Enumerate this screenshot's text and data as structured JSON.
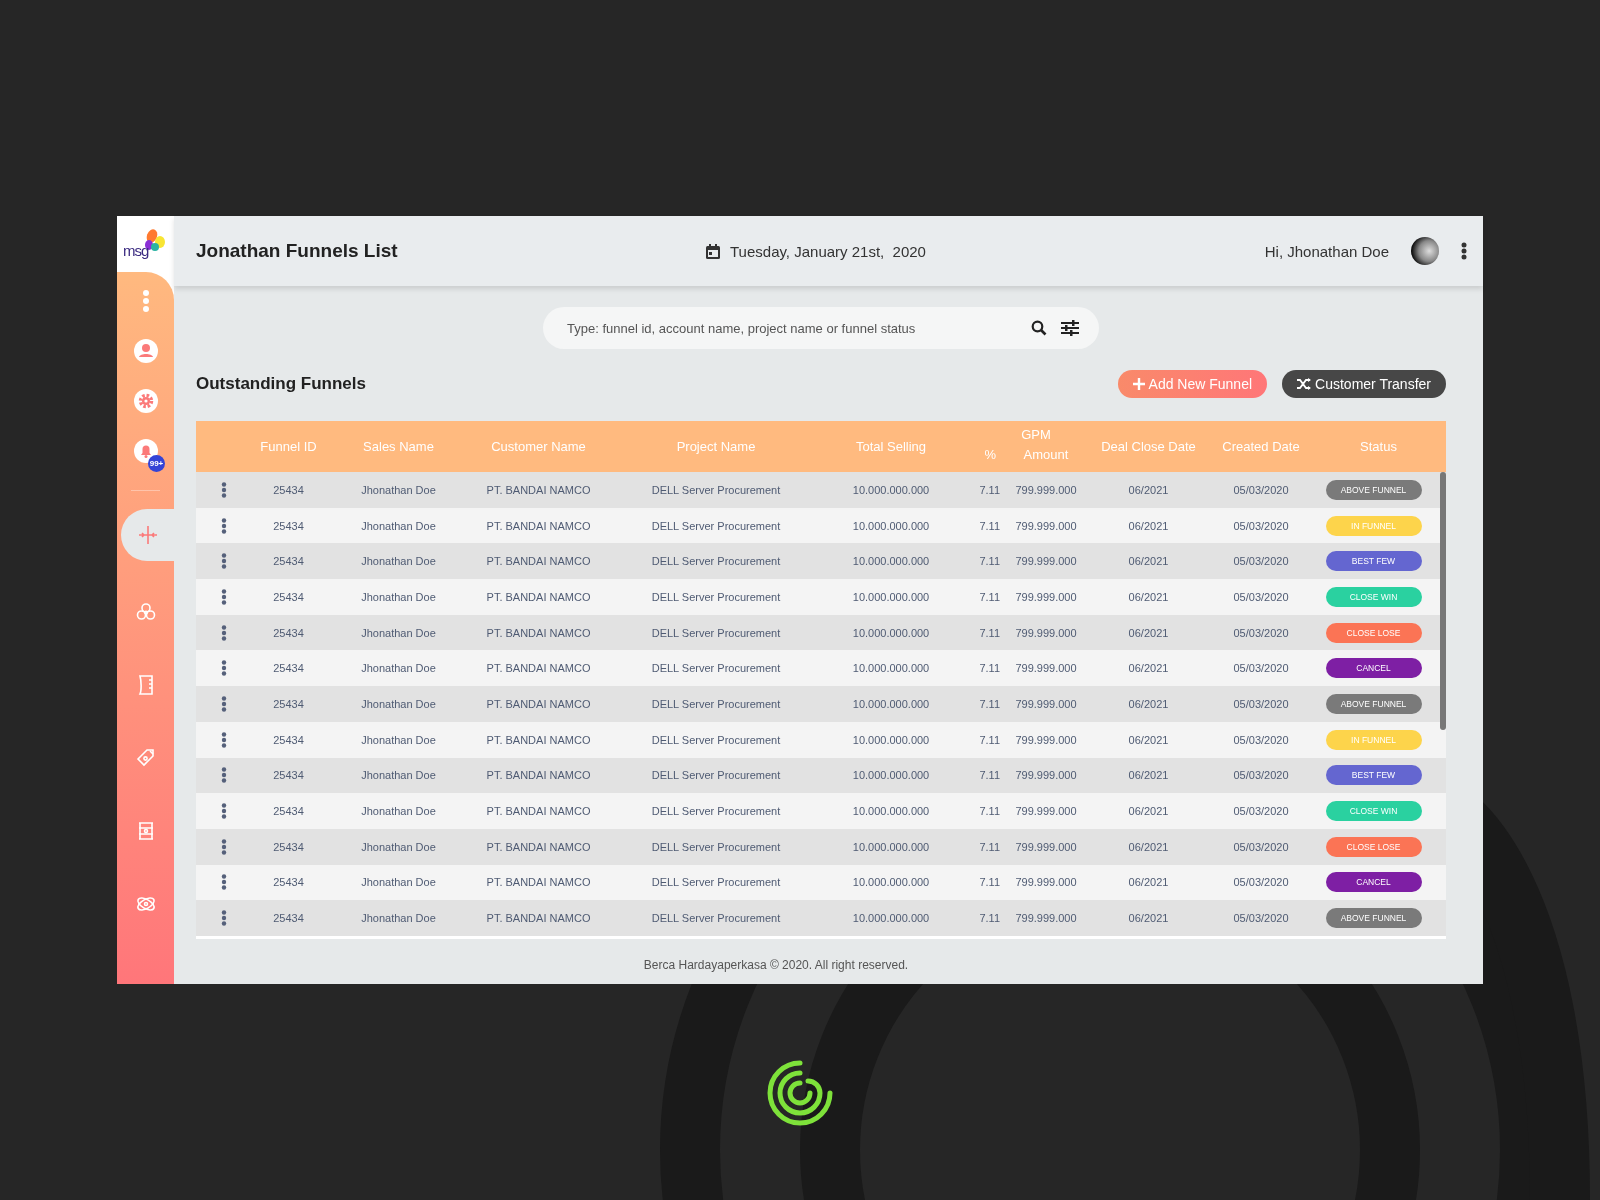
{
  "logo_text": "msg",
  "header": {
    "title": "Jonathan Funnels List",
    "date": "Tuesday, January 21st,  2020",
    "greeting": "Hi, Jhonathan Doe"
  },
  "sidebar": {
    "items": [
      {
        "kind": "more",
        "selected": false
      },
      {
        "kind": "user",
        "selected": false
      },
      {
        "kind": "settings",
        "selected": false
      },
      {
        "kind": "bell",
        "selected": false,
        "badge": "99+"
      },
      {
        "kind": "crosshair",
        "selected": true
      },
      {
        "kind": "biohazard",
        "selected": false
      },
      {
        "kind": "ruler",
        "selected": false
      },
      {
        "kind": "tag",
        "selected": false
      },
      {
        "kind": "barrel",
        "selected": false
      },
      {
        "kind": "atom",
        "selected": false
      }
    ]
  },
  "search": {
    "placeholder": "Type: funnel id, account name, project name or funnel status"
  },
  "section_title": "Outstanding Funnels",
  "buttons": [
    {
      "kind": "add",
      "label": "Add New Funnel"
    },
    {
      "kind": "transfer",
      "label": "Customer Transfer"
    }
  ],
  "table": {
    "columns": [
      "Funnel ID",
      "Sales Name",
      "Customer Name",
      "Project Name",
      "Total Selling",
      {
        "group": "GPM",
        "sub": [
          "%",
          "Amount"
        ]
      },
      "Deal Close Date",
      "Created Date",
      "Status"
    ],
    "rows": [
      {
        "id": "25434",
        "sales": "Jhonathan Doe",
        "customer": "PT. BANDAI NAMCO",
        "project": "DELL Server Procurement",
        "total": "10.000.000.000",
        "gpm_pct": "7.11",
        "gpm_amount": "799.999.000",
        "deal_close": "06/2021",
        "created": "05/03/2020",
        "status": "ABOVE FUNNEL",
        "color": "#7a7a7a"
      },
      {
        "id": "25434",
        "sales": "Jhonathan Doe",
        "customer": "PT. BANDAI NAMCO",
        "project": "DELL Server Procurement",
        "total": "10.000.000.000",
        "gpm_pct": "7.11",
        "gpm_amount": "799.999.000",
        "deal_close": "06/2021",
        "created": "05/03/2020",
        "status": "IN FUNNEL",
        "color": "#fdd44b"
      },
      {
        "id": "25434",
        "sales": "Jhonathan Doe",
        "customer": "PT. BANDAI NAMCO",
        "project": "DELL Server Procurement",
        "total": "10.000.000.000",
        "gpm_pct": "7.11",
        "gpm_amount": "799.999.000",
        "deal_close": "06/2021",
        "created": "05/03/2020",
        "status": "BEST FEW",
        "color": "#6466d0"
      },
      {
        "id": "25434",
        "sales": "Jhonathan Doe",
        "customer": "PT. BANDAI NAMCO",
        "project": "DELL Server Procurement",
        "total": "10.000.000.000",
        "gpm_pct": "7.11",
        "gpm_amount": "799.999.000",
        "deal_close": "06/2021",
        "created": "05/03/2020",
        "status": "CLOSE WIN",
        "color": "#2ad1a0"
      },
      {
        "id": "25434",
        "sales": "Jhonathan Doe",
        "customer": "PT. BANDAI NAMCO",
        "project": "DELL Server Procurement",
        "total": "10.000.000.000",
        "gpm_pct": "7.11",
        "gpm_amount": "799.999.000",
        "deal_close": "06/2021",
        "created": "05/03/2020",
        "status": "CLOSE LOSE",
        "color": "#fb7455"
      },
      {
        "id": "25434",
        "sales": "Jhonathan Doe",
        "customer": "PT. BANDAI NAMCO",
        "project": "DELL Server Procurement",
        "total": "10.000.000.000",
        "gpm_pct": "7.11",
        "gpm_amount": "799.999.000",
        "deal_close": "06/2021",
        "created": "05/03/2020",
        "status": "CANCEL",
        "color": "#7e1fa4"
      },
      {
        "id": "25434",
        "sales": "Jhonathan Doe",
        "customer": "PT. BANDAI NAMCO",
        "project": "DELL Server Procurement",
        "total": "10.000.000.000",
        "gpm_pct": "7.11",
        "gpm_amount": "799.999.000",
        "deal_close": "06/2021",
        "created": "05/03/2020",
        "status": "ABOVE FUNNEL",
        "color": "#7a7a7a"
      },
      {
        "id": "25434",
        "sales": "Jhonathan Doe",
        "customer": "PT. BANDAI NAMCO",
        "project": "DELL Server Procurement",
        "total": "10.000.000.000",
        "gpm_pct": "7.11",
        "gpm_amount": "799.999.000",
        "deal_close": "06/2021",
        "created": "05/03/2020",
        "status": "IN FUNNEL",
        "color": "#fdd44b"
      },
      {
        "id": "25434",
        "sales": "Jhonathan Doe",
        "customer": "PT. BANDAI NAMCO",
        "project": "DELL Server Procurement",
        "total": "10.000.000.000",
        "gpm_pct": "7.11",
        "gpm_amount": "799.999.000",
        "deal_close": "06/2021",
        "created": "05/03/2020",
        "status": "BEST FEW",
        "color": "#6466d0"
      },
      {
        "id": "25434",
        "sales": "Jhonathan Doe",
        "customer": "PT. BANDAI NAMCO",
        "project": "DELL Server Procurement",
        "total": "10.000.000.000",
        "gpm_pct": "7.11",
        "gpm_amount": "799.999.000",
        "deal_close": "06/2021",
        "created": "05/03/2020",
        "status": "CLOSE WIN",
        "color": "#2ad1a0"
      },
      {
        "id": "25434",
        "sales": "Jhonathan Doe",
        "customer": "PT. BANDAI NAMCO",
        "project": "DELL Server Procurement",
        "total": "10.000.000.000",
        "gpm_pct": "7.11",
        "gpm_amount": "799.999.000",
        "deal_close": "06/2021",
        "created": "05/03/2020",
        "status": "CLOSE LOSE",
        "color": "#fb7455"
      },
      {
        "id": "25434",
        "sales": "Jhonathan Doe",
        "customer": "PT. BANDAI NAMCO",
        "project": "DELL Server Procurement",
        "total": "10.000.000.000",
        "gpm_pct": "7.11",
        "gpm_amount": "799.999.000",
        "deal_close": "06/2021",
        "created": "05/03/2020",
        "status": "CANCEL",
        "color": "#7e1fa4"
      },
      {
        "id": "25434",
        "sales": "Jhonathan Doe",
        "customer": "PT. BANDAI NAMCO",
        "project": "DELL Server Procurement",
        "total": "10.000.000.000",
        "gpm_pct": "7.11",
        "gpm_amount": "799.999.000",
        "deal_close": "06/2021",
        "created": "05/03/2020",
        "status": "ABOVE FUNNEL",
        "color": "#7a7a7a"
      }
    ]
  },
  "footer": "Berca Hardayaperkasa © 2020. All right reserved."
}
